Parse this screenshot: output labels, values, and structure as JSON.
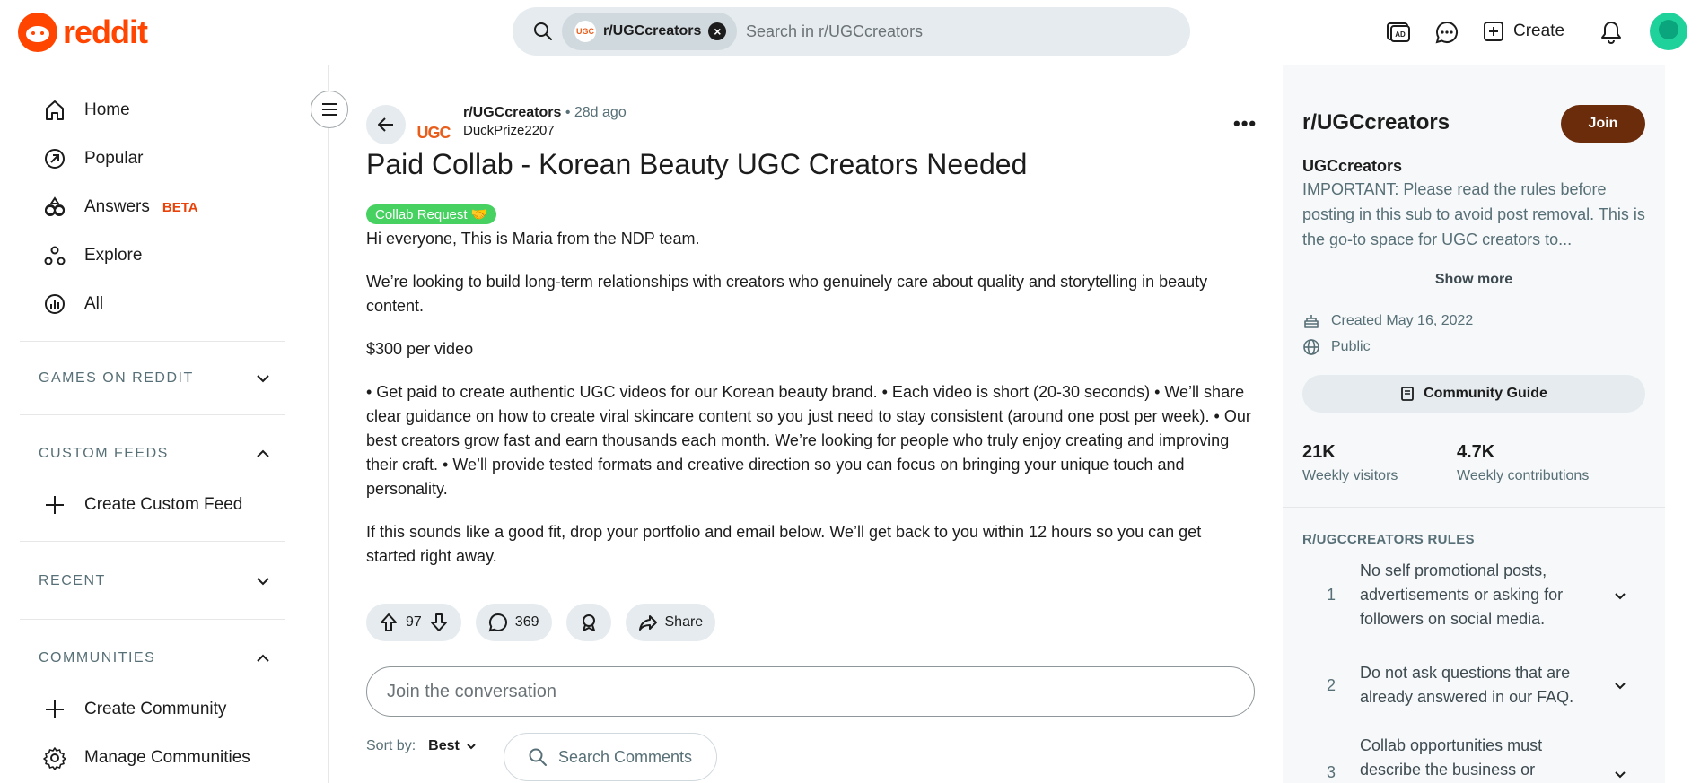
{
  "header": {
    "brand": "reddit",
    "search_chip": "r/UGCcreators",
    "search_chip_avatar": "UGC",
    "search_placeholder": "Search in r/UGCcreators",
    "create_label": "Create"
  },
  "sidebar": {
    "items": [
      {
        "label": "Home",
        "icon": "home-icon"
      },
      {
        "label": "Popular",
        "icon": "popular-icon"
      },
      {
        "label": "Answers",
        "icon": "answers-icon",
        "badge": "BETA"
      },
      {
        "label": "Explore",
        "icon": "explore-icon"
      },
      {
        "label": "All",
        "icon": "all-icon"
      }
    ],
    "sections": {
      "games": "GAMES ON REDDIT",
      "custom_feeds": "CUSTOM FEEDS",
      "create_custom_feed": "Create Custom Feed",
      "recent": "RECENT",
      "communities": "COMMUNITIES",
      "create_community": "Create Community",
      "manage_communities": "Manage Communities"
    }
  },
  "post": {
    "subreddit": "r/UGCcreators",
    "age": "• 28d ago",
    "author": "DuckPrize2207",
    "avatar_text": "UGC",
    "title": "Paid Collab - Korean Beauty UGC Creators Needed",
    "flair": "Collab Request 🤝",
    "body": [
      "Hi everyone, This is Maria from the NDP team.",
      "We’re looking to build long-term relationships with creators who genuinely care about quality and storytelling in beauty content.",
      "$300 per video",
      "• Get paid to create authentic UGC videos for our Korean beauty brand. • Each video is short (20-30 seconds) • We’ll share clear guidance on how to create viral skincare content so you just need to stay consistent (around one post per week). • Our best creators grow fast and earn thousands each month. We’re looking for people who truly enjoy creating and improving their craft. • We’ll provide tested formats and creative direction so you can focus on bringing your unique touch and personality.",
      "If this sounds like a good fit, drop your portfolio and email below. We’ll get back to you within 12 hours so you can get started right away."
    ],
    "votes": "97",
    "comments": "369",
    "share_label": "Share",
    "join_placeholder": "Join the conversation",
    "sort_label": "Sort by:",
    "sort_value": "Best",
    "search_comments_placeholder": "Search Comments"
  },
  "community": {
    "title": "r/UGCcreators",
    "join_label": "Join",
    "name": "UGCcreators",
    "description": "IMPORTANT: Please read the rules before posting in this sub to avoid post removal. This is the go-to space for UGC creators to...",
    "show_more": "Show more",
    "created": "Created May 16, 2022",
    "visibility": "Public",
    "guide_label": "Community Guide",
    "weekly_visitors": "21K",
    "weekly_visitors_label": "Weekly visitors",
    "weekly_contributions": "4.7K",
    "weekly_contributions_label": "Weekly contributions",
    "rules_heading": "R/UGCCREATORS RULES",
    "rules": [
      {
        "n": "1",
        "text": "No self promotional posts, advertisements or asking for followers on social media."
      },
      {
        "n": "2",
        "text": "Do not ask questions that are already answered in our FAQ."
      },
      {
        "n": "3",
        "text": "Collab opportunities must describe the business or"
      }
    ]
  },
  "colors": {
    "brand": "#ff4500",
    "join": "#6b2c0b",
    "flair": "#46d160"
  }
}
